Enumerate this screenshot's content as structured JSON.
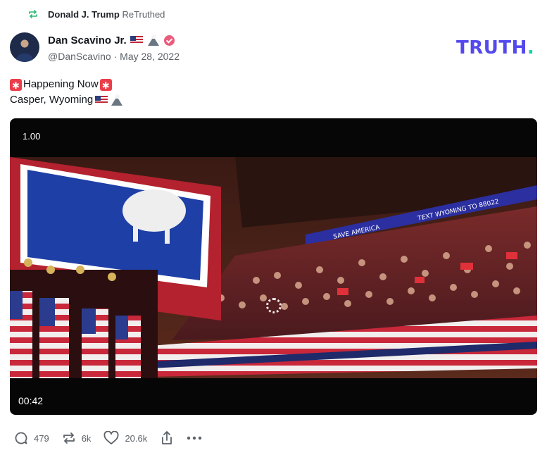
{
  "retruth": {
    "icon": "retruth-icon",
    "user": "Donald J. Trump",
    "label": "ReTruthed",
    "color": "#2bb673"
  },
  "author": {
    "avatar": "avatar",
    "name": "Dan Scavino Jr.",
    "name_emojis": [
      "us-flag-emoji",
      "mountain-emoji"
    ],
    "verified_icon": "verified-badge-icon",
    "handle": "@DanScavino",
    "separator": "·",
    "date": "May 28, 2022"
  },
  "brand": {
    "logo_text": "TRUTH",
    "logo_dot": ".",
    "color": "#5448ee",
    "dot_color": "#0fd3a8"
  },
  "post": {
    "line1": "Happening Now",
    "line1_emojis": [
      "siren-emoji",
      "siren-emoji"
    ],
    "line2": "Casper, Wyoming",
    "line2_emojis": [
      "us-flag-emoji",
      "mountain-emoji"
    ]
  },
  "video": {
    "playback_speed": "1.00",
    "duration": "00:42",
    "loading_icon": "loading-spinner-icon",
    "banner_text": "TEXT WYOMING TO 88022",
    "banner_text_2": "SAVE AMERICA"
  },
  "actions": [
    {
      "name": "reply",
      "icon": "reply-icon",
      "count": "479"
    },
    {
      "name": "retruth",
      "icon": "retruth-icon",
      "count": "6k"
    },
    {
      "name": "like",
      "icon": "heart-icon",
      "count": "20.6k"
    },
    {
      "name": "share",
      "icon": "share-icon",
      "count": ""
    },
    {
      "name": "more",
      "icon": "more-icon",
      "count": ""
    }
  ]
}
